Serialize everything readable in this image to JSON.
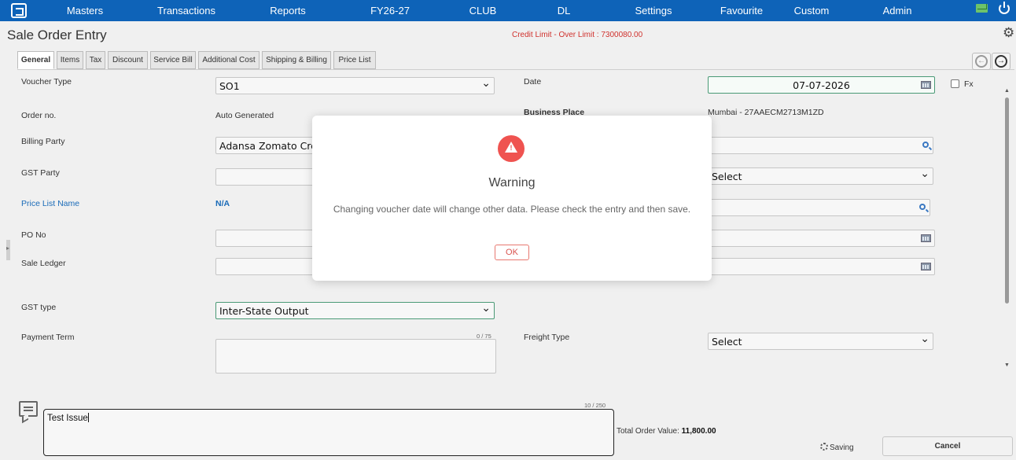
{
  "nav": {
    "items": [
      "Masters",
      "Transactions",
      "Reports",
      "FY26-27",
      "CLUB",
      "DL",
      "Settings",
      "Favourite",
      "Custom",
      "Admin"
    ]
  },
  "header": {
    "title": "Sale Order Entry",
    "credit_limit": "Credit Limit - Over Limit : 7300080.00"
  },
  "tabs": [
    "General",
    "Items",
    "Tax",
    "Discount",
    "Service Bill",
    "Additional Cost",
    "Shipping & Billing",
    "Price List"
  ],
  "form": {
    "voucher_type_label": "Voucher Type",
    "voucher_type_value": "SO1",
    "date_label": "Date",
    "date_value": "07-07-2026",
    "fx_label": "Fx",
    "order_no_label": "Order no.",
    "order_no_value": "Auto Generated",
    "business_place_label": "Business Place",
    "business_place_value": "Mumbai - 27AAECM2713M1ZD",
    "billing_party_label": "Billing Party",
    "billing_party_value": "Adansa Zomato Credi",
    "gst_party_label": "GST Party",
    "right_select_value": "Select",
    "price_list_label": "Price List Name",
    "price_list_value": "N/A",
    "po_no_label": "PO No",
    "sale_ledger_label": "Sale Ledger",
    "gst_type_label": "GST type",
    "gst_type_value": "Inter-State Output",
    "payment_term_label": "Payment Term",
    "payment_term_counter": "0 / 75",
    "freight_type_label": "Freight Type",
    "freight_type_value": "Select"
  },
  "footer": {
    "remarks_counter": "10 / 250",
    "remarks_value": "Test Issue",
    "total_label": "Total Order Value:",
    "total_value": "11,800.00",
    "saving_label": "Saving",
    "cancel_label": "Cancel"
  },
  "modal": {
    "title": "Warning",
    "message": "Changing voucher date will change other data. Please check the entry and then save.",
    "ok_label": "OK"
  },
  "colors": {
    "nav_bg": "#0e63b8",
    "credit_limit": "#d0312d",
    "warning_icon": "#ef5350",
    "link": "#1a6bb8"
  },
  "icons": [
    "logo-icon",
    "mail-icon",
    "power-icon",
    "gear-icon",
    "calendar-icon",
    "search-icon",
    "warning-icon",
    "comment-icon",
    "spinner-icon"
  ]
}
